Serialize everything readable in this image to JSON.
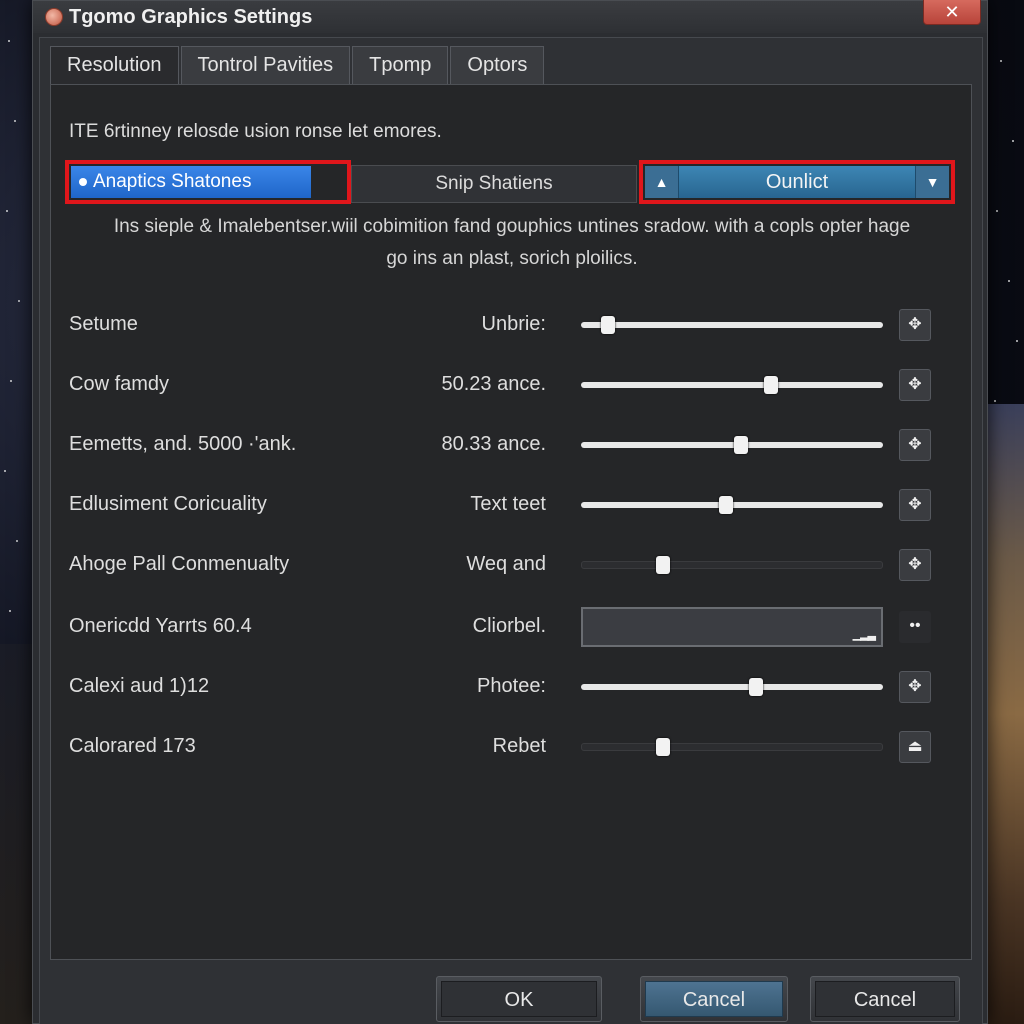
{
  "window": {
    "title": "Tgomo Graphics Settings",
    "close_glyph": "✕"
  },
  "tabs": [
    {
      "label": "Resolution",
      "active": true
    },
    {
      "label": "Tontrol Pavities",
      "active": false
    },
    {
      "label": "Tpomp",
      "active": false
    },
    {
      "label": "Optors",
      "active": false
    }
  ],
  "intro_text": "ITE 6rtinney relosde usion ronse let emores.",
  "segments": {
    "left_label": "Anaptics Shatones",
    "middle_label": "Snip Shatiens",
    "dropdown_label": "Ounlict",
    "dropdown_up_glyph": "▲",
    "dropdown_down_glyph": "▼"
  },
  "description": {
    "line1": "Ins sieple & Imalebentser.wiil cobimition fand gouphics untines sradow. with a copls opter hage",
    "line2": "go ins an plast, sorich ploilics."
  },
  "rows": [
    {
      "label": "Setume",
      "value": "Unbrie:",
      "kind": "slider",
      "level": 0.09,
      "track": "light",
      "button": "✥"
    },
    {
      "label": "Cow famdy",
      "value": "50.23 ance.",
      "kind": "slider",
      "level": 0.63,
      "track": "light",
      "button": "✥"
    },
    {
      "label": "Eemetts, and. 5000 ·'ank.",
      "value": "80.33 ance.",
      "kind": "slider",
      "level": 0.53,
      "track": "light",
      "button": "✥"
    },
    {
      "label": "Edlusiment Coricuality",
      "value": "Text teet",
      "kind": "slider",
      "level": 0.48,
      "track": "light",
      "button": "✥"
    },
    {
      "label": "Ahoge Pall Conmenualty",
      "value": "Weq and",
      "kind": "slider",
      "level": 0.27,
      "track": "dark",
      "button": "✥"
    },
    {
      "label": "Onericdd Yarrts 60.4",
      "value": "Cliorbel.",
      "kind": "field",
      "button": "••"
    },
    {
      "label": "Calexi aud 1)12",
      "value": "Photee:",
      "kind": "slider",
      "level": 0.58,
      "track": "light",
      "button": "✥"
    },
    {
      "label": "Calorared 173",
      "value": "Rebet",
      "kind": "slider",
      "level": 0.27,
      "track": "dark",
      "button": "⏏"
    }
  ],
  "footer": {
    "ok_label": "OK",
    "cancel_label": "Cancel",
    "cancel2_label": "Cancel"
  },
  "colors": {
    "highlight_red": "#e0161b",
    "accent_blue": "#2a78df",
    "dropdown_blue": "#34799f"
  }
}
